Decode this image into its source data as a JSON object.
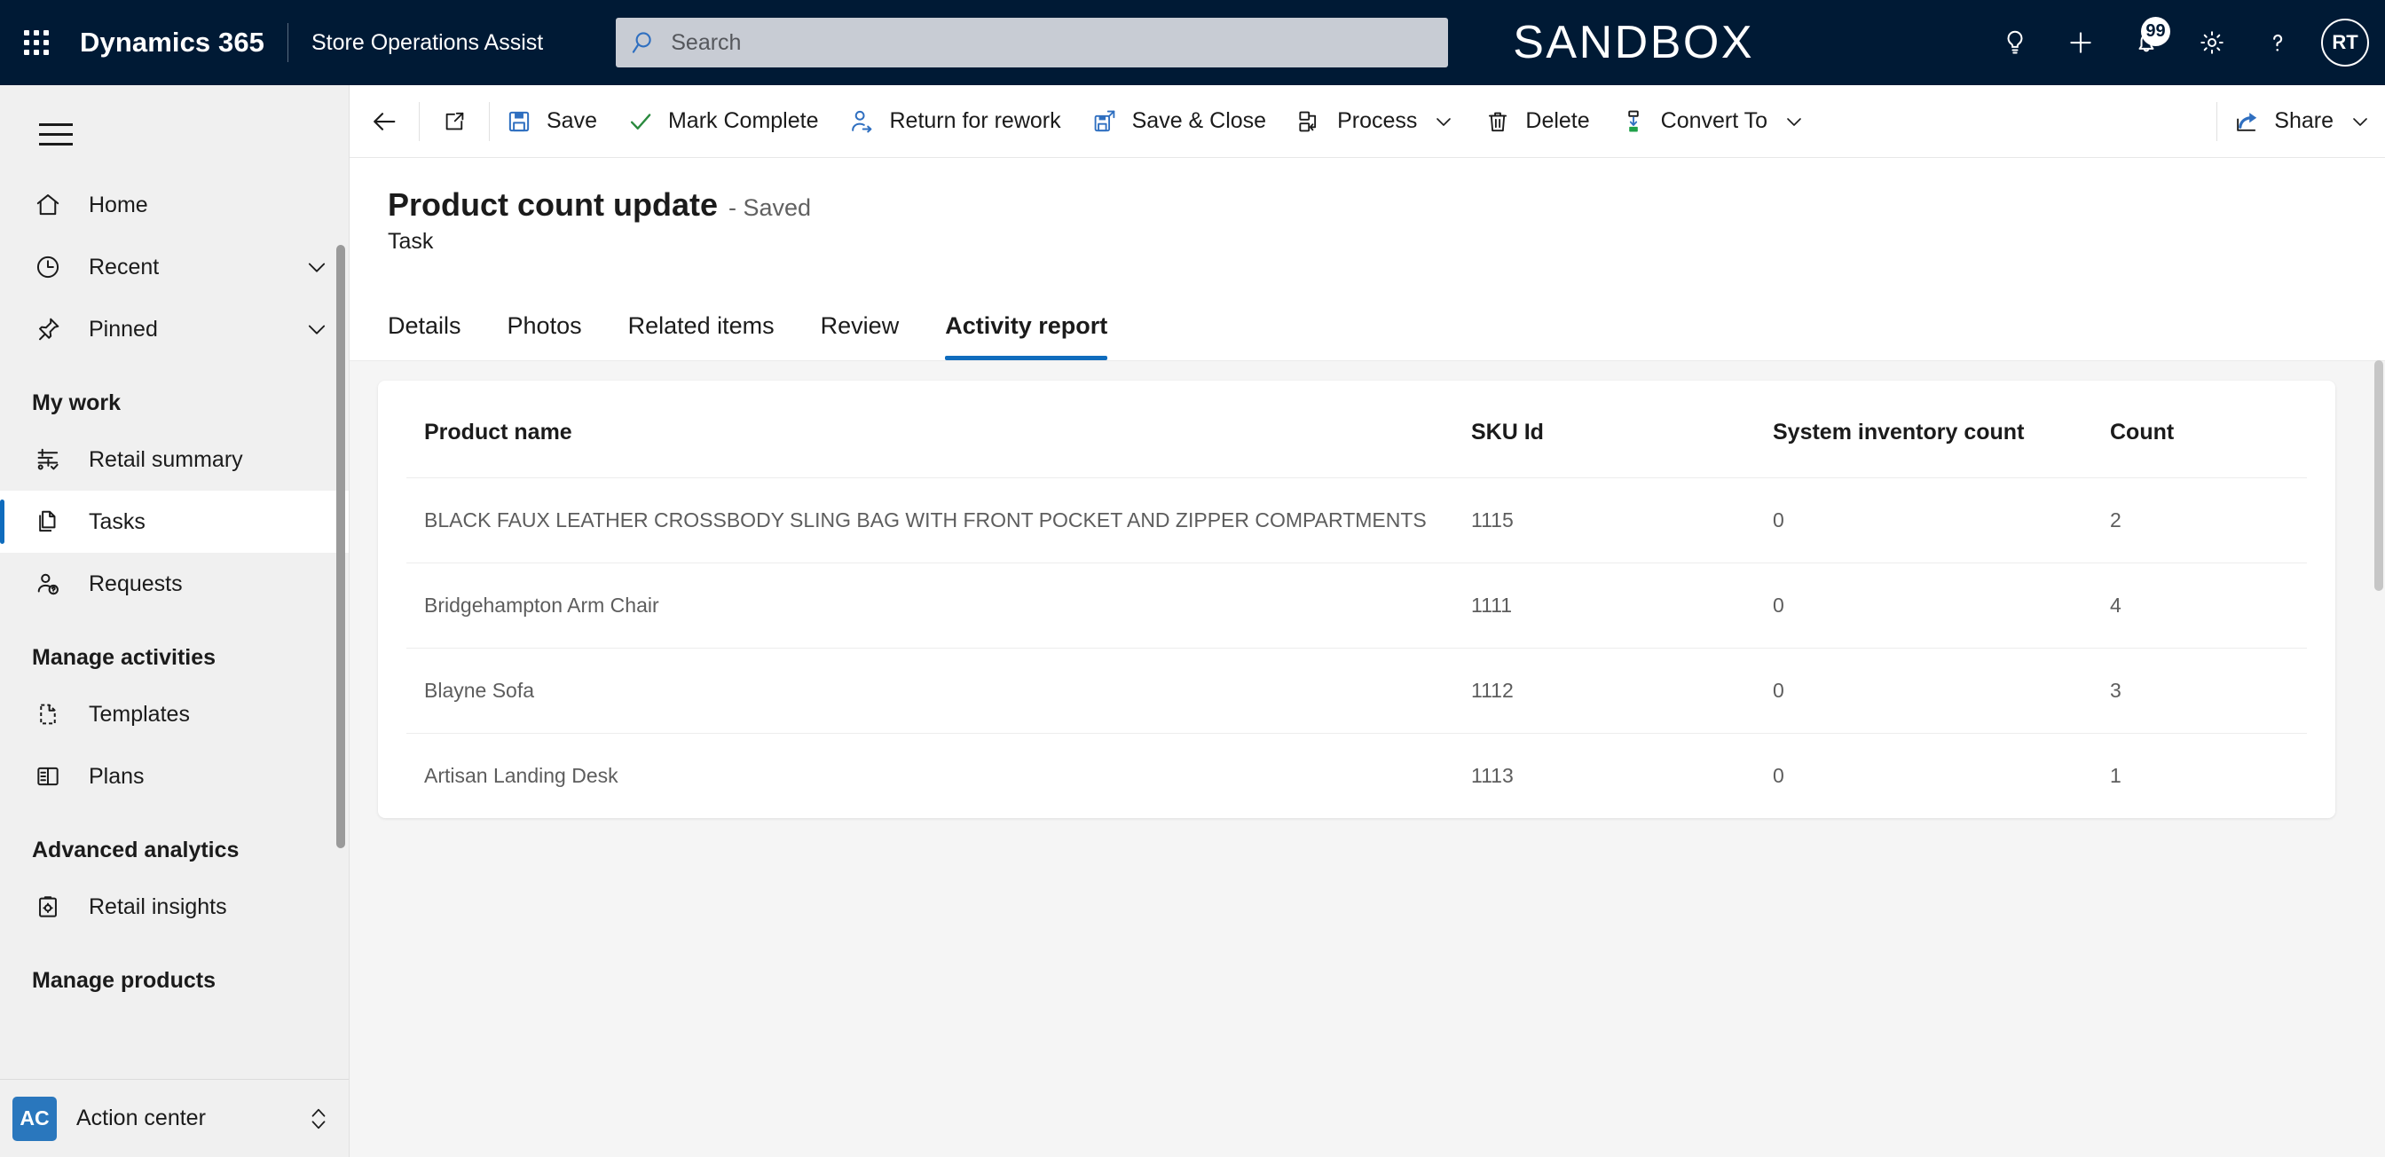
{
  "appbar": {
    "waffle_label": "app-launcher",
    "brand": "Dynamics 365",
    "app_name": "Store Operations Assist",
    "environment_label": "SANDBOX",
    "search": {
      "placeholder": "Search",
      "value": ""
    },
    "icons": [
      {
        "name": "lightbulb-icon",
        "title": "Tips"
      },
      {
        "name": "plus-icon",
        "title": "Quick create"
      },
      {
        "name": "notification-bell-icon",
        "title": "Notifications",
        "badge": "99"
      },
      {
        "name": "gear-icon",
        "title": "Settings"
      },
      {
        "name": "help-icon",
        "title": "Help"
      }
    ],
    "avatar_initials": "RT",
    "accent_color": "#0f6cbd",
    "bar_color": "#001a35"
  },
  "sidebar": {
    "top_items": [
      {
        "label": "Home",
        "icon": "home-icon",
        "expandable": false,
        "selected": false
      },
      {
        "label": "Recent",
        "icon": "clock-icon",
        "expandable": true,
        "selected": false
      },
      {
        "label": "Pinned",
        "icon": "pin-icon",
        "expandable": true,
        "selected": false
      }
    ],
    "groups": [
      {
        "header": "My work",
        "items": [
          {
            "label": "Retail summary",
            "icon": "retail-summary-icon",
            "selected": false
          },
          {
            "label": "Tasks",
            "icon": "tasks-icon",
            "selected": true
          },
          {
            "label": "Requests",
            "icon": "requests-icon",
            "selected": false
          }
        ]
      },
      {
        "header": "Manage activities",
        "items": [
          {
            "label": "Templates",
            "icon": "template-icon",
            "selected": false
          },
          {
            "label": "Plans",
            "icon": "plans-icon",
            "selected": false
          }
        ]
      },
      {
        "header": "Advanced analytics",
        "items": [
          {
            "label": "Retail insights",
            "icon": "retail-insights-icon",
            "selected": false
          }
        ]
      },
      {
        "header": "Manage products",
        "items": []
      }
    ],
    "action_center": {
      "badge": "AC",
      "label": "Action center"
    }
  },
  "commandbar": {
    "back_label": "Back",
    "popout_label": "Open in new window",
    "buttons": [
      {
        "label": "Save",
        "icon": "save-icon",
        "dropdown": false
      },
      {
        "label": "Mark Complete",
        "icon": "checkmark-icon",
        "dropdown": false
      },
      {
        "label": "Return for rework",
        "icon": "person-arrow-icon",
        "dropdown": false
      },
      {
        "label": "Save & Close",
        "icon": "save-close-icon",
        "dropdown": false
      },
      {
        "label": "Process",
        "icon": "process-icon",
        "dropdown": true
      },
      {
        "label": "Delete",
        "icon": "trash-icon",
        "dropdown": false
      },
      {
        "label": "Convert To",
        "icon": "convert-icon",
        "dropdown": true
      }
    ],
    "share": {
      "label": "Share",
      "icon": "share-icon",
      "dropdown": true
    }
  },
  "record": {
    "title": "Product count update",
    "status": "- Saved",
    "entity": "Task",
    "tabs": [
      {
        "label": "Details",
        "active": false
      },
      {
        "label": "Photos",
        "active": false
      },
      {
        "label": "Related items",
        "active": false
      },
      {
        "label": "Review",
        "active": false
      },
      {
        "label": "Activity report",
        "active": true
      }
    ]
  },
  "activity_report": {
    "columns": [
      "Product name",
      "SKU Id",
      "System inventory count",
      "Count"
    ],
    "rows": [
      {
        "product_name": "BLACK FAUX LEATHER CROSSBODY SLING BAG WITH FRONT POCKET AND ZIPPER COMPARTMENTS",
        "sku_id": "1115",
        "system_inventory_count": "0",
        "count": "2"
      },
      {
        "product_name": "Bridgehampton Arm Chair",
        "sku_id": "1111",
        "system_inventory_count": "0",
        "count": "4"
      },
      {
        "product_name": "Blayne Sofa",
        "sku_id": "1112",
        "system_inventory_count": "0",
        "count": "3"
      },
      {
        "product_name": "Artisan Landing Desk",
        "sku_id": "1113",
        "system_inventory_count": "0",
        "count": "1"
      }
    ]
  }
}
